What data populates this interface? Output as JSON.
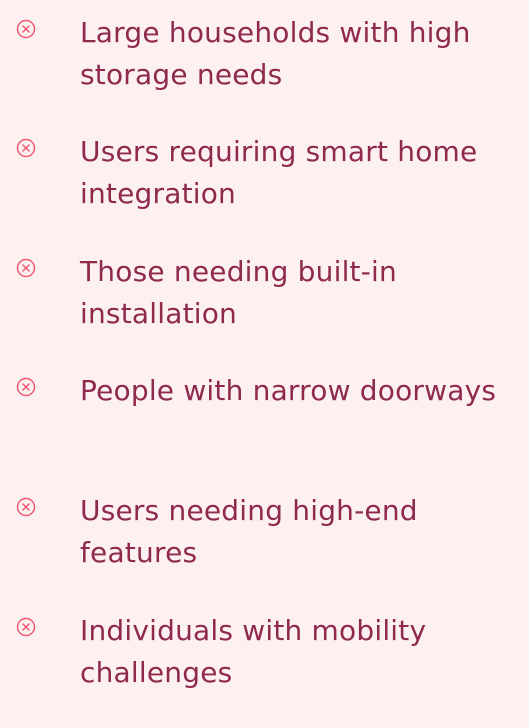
{
  "colors": {
    "background": "#fcf0f1",
    "text": "#8f2a4d",
    "icon": "#ef5a72"
  },
  "list": {
    "items": [
      {
        "icon": "x-circle-icon",
        "label": "Large households with high storage needs"
      },
      {
        "icon": "x-circle-icon",
        "label": "Users requiring smart home integration"
      },
      {
        "icon": "x-circle-icon",
        "label": "Those needing built-in installation"
      },
      {
        "icon": "x-circle-icon",
        "label": "People with narrow doorways"
      },
      {
        "icon": "x-circle-icon",
        "label": "Users needing high-end features"
      },
      {
        "icon": "x-circle-icon",
        "label": "Individuals with mobility challenges"
      }
    ]
  }
}
